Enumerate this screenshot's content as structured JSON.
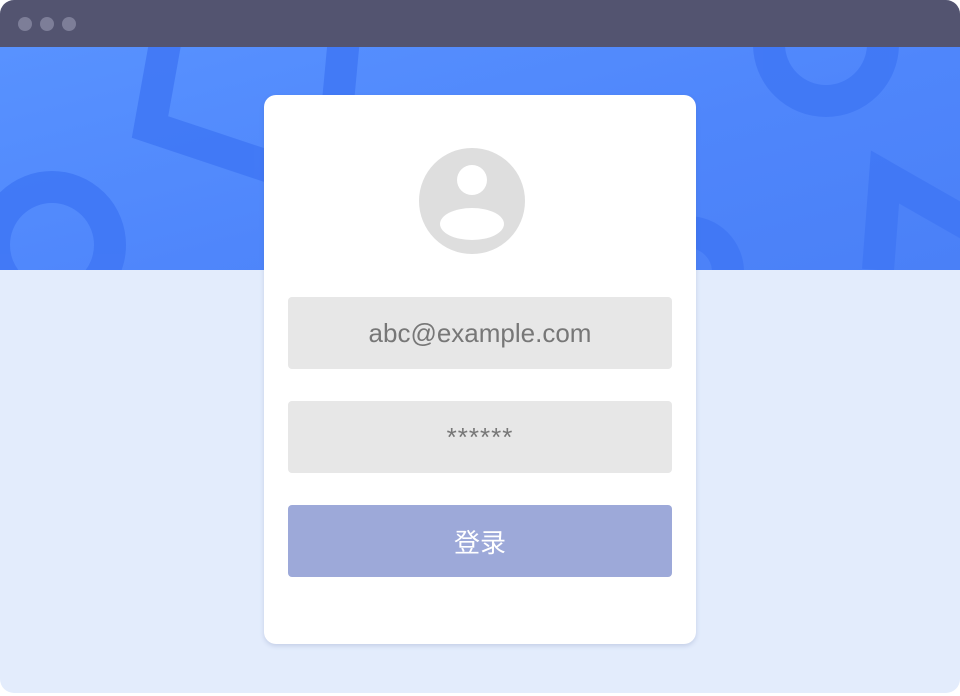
{
  "window": {
    "controls": [
      "dot",
      "dot",
      "dot"
    ]
  },
  "login": {
    "avatar_icon": "user-avatar-icon",
    "email_placeholder": "abc@example.com",
    "password_placeholder": "******",
    "submit_label": "登录"
  },
  "colors": {
    "titlebar": "#535470",
    "hero": "#5190fe",
    "page_background": "#e3ecfc",
    "button": "#9da9d9",
    "field": "#e7e7e7"
  }
}
